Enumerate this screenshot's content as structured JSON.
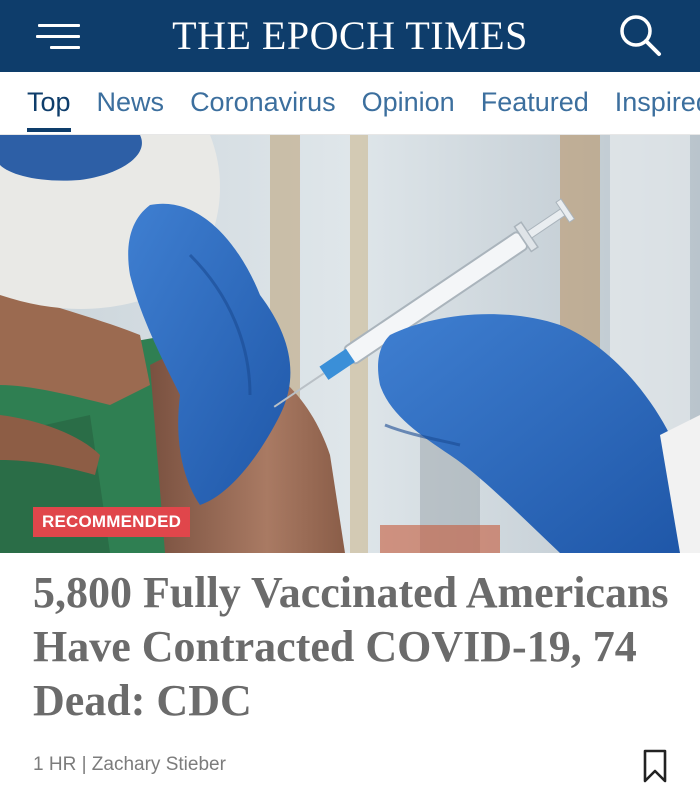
{
  "header": {
    "brand": "THE EPOCH TIMES",
    "menu_icon": "hamburger-menu-icon",
    "search_icon": "search-icon",
    "background_color": "#0e3d6b"
  },
  "nav": {
    "tabs": [
      {
        "label": "Top",
        "active": true
      },
      {
        "label": "News",
        "active": false
      },
      {
        "label": "Coronavirus",
        "active": false
      },
      {
        "label": "Opinion",
        "active": false
      },
      {
        "label": "Featured",
        "active": false
      },
      {
        "label": "Inspired",
        "active": false
      }
    ],
    "active_color": "#0e3d6b",
    "inactive_color": "#3c6f9e"
  },
  "article": {
    "badge": "RECOMMENDED",
    "badge_color": "#e0464b",
    "headline": "5,800 Fully Vaccinated Americans Have Contracted COVID-19, 74 Dead: CDC",
    "time": "1 HR",
    "separator": "|",
    "author": "Zachary Stieber",
    "bookmark_icon": "bookmark-icon"
  }
}
